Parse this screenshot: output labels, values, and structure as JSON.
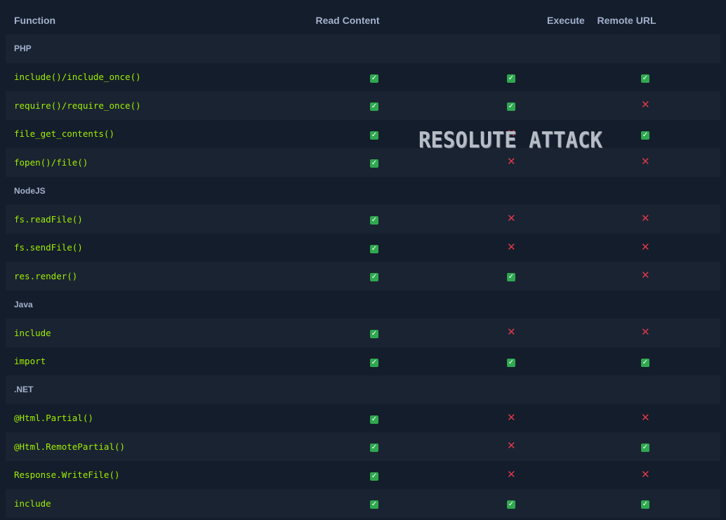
{
  "table": {
    "headers": [
      "Function",
      "Read Content",
      "Execute",
      "Remote URL"
    ],
    "groups": [
      {
        "name": "PHP",
        "rows": [
          {
            "fn": "include()/include_once()",
            "read": true,
            "execute": true,
            "remote": true
          },
          {
            "fn": "require()/require_once()",
            "read": true,
            "execute": true,
            "remote": false
          },
          {
            "fn": "file_get_contents()",
            "read": true,
            "execute": false,
            "remote": true
          },
          {
            "fn": "fopen()/file()",
            "read": true,
            "execute": false,
            "remote": false
          }
        ]
      },
      {
        "name": "NodeJS",
        "rows": [
          {
            "fn": "fs.readFile()",
            "read": true,
            "execute": false,
            "remote": false
          },
          {
            "fn": "fs.sendFile()",
            "read": true,
            "execute": false,
            "remote": false
          },
          {
            "fn": "res.render()",
            "read": true,
            "execute": true,
            "remote": false
          }
        ]
      },
      {
        "name": "Java",
        "rows": [
          {
            "fn": "include",
            "read": true,
            "execute": false,
            "remote": false
          },
          {
            "fn": "import",
            "read": true,
            "execute": true,
            "remote": true
          }
        ]
      },
      {
        "name": ".NET",
        "rows": [
          {
            "fn": "@Html.Partial()",
            "read": true,
            "execute": false,
            "remote": false
          },
          {
            "fn": "@Html.RemotePartial()",
            "read": true,
            "execute": false,
            "remote": true
          },
          {
            "fn": "Response.WriteFile()",
            "read": true,
            "execute": false,
            "remote": false
          },
          {
            "fn": "include",
            "read": true,
            "execute": true,
            "remote": true
          }
        ]
      }
    ]
  },
  "icons": {
    "yes": "check-mark-icon",
    "no": "cross-mark-icon"
  },
  "colors": {
    "background": "#141d2b",
    "row_alt": "#1a2332",
    "function_text": "#9fef00",
    "header_text": "#a4b1cd",
    "check": "#2fa84f",
    "cross": "#e0384a"
  },
  "watermark": "RESOLUTE ATTACK"
}
